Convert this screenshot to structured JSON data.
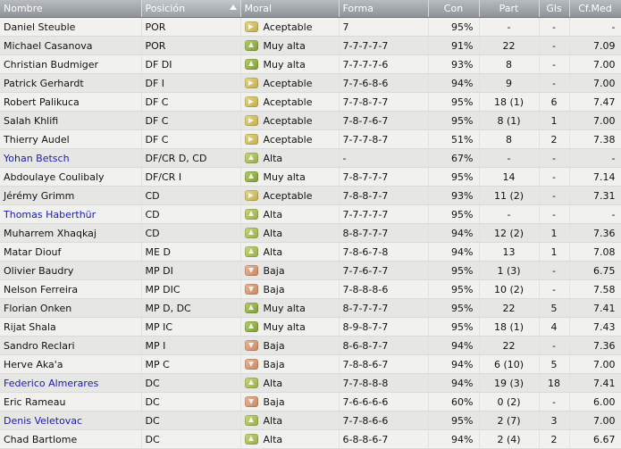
{
  "columns": {
    "name": "Nombre",
    "position": "Posición",
    "morale": "Moral",
    "form": "Forma",
    "condition": "Con",
    "appearances": "Part",
    "goals": "Gls",
    "avg_rating": "Cf.Med"
  },
  "sorted_column": "position",
  "rows": [
    {
      "name": "Daniel Steuble",
      "link": false,
      "position": "POR",
      "morale": "Aceptable",
      "morale_icon": "aceptable",
      "form": "7",
      "condition": "95%",
      "appearances": "-",
      "goals": "-",
      "avg_rating": "-"
    },
    {
      "name": "Michael Casanova",
      "link": false,
      "position": "POR",
      "morale": "Muy alta",
      "morale_icon": "muyalta",
      "form": "7-7-7-7-7",
      "condition": "91%",
      "appearances": "22",
      "goals": "-",
      "avg_rating": "7.09"
    },
    {
      "name": "Christian Budmiger",
      "link": false,
      "position": "DF DI",
      "morale": "Muy alta",
      "morale_icon": "muyalta",
      "form": "7-7-7-7-6",
      "condition": "93%",
      "appearances": "8",
      "goals": "-",
      "avg_rating": "7.00"
    },
    {
      "name": "Patrick Gerhardt",
      "link": false,
      "position": "DF I",
      "morale": "Aceptable",
      "morale_icon": "aceptable",
      "form": "7-7-6-8-6",
      "condition": "94%",
      "appearances": "9",
      "goals": "-",
      "avg_rating": "7.00"
    },
    {
      "name": "Robert Palikuca",
      "link": false,
      "position": "DF C",
      "morale": "Aceptable",
      "morale_icon": "aceptable",
      "form": "7-7-8-7-7",
      "condition": "95%",
      "appearances": "18 (1)",
      "goals": "6",
      "avg_rating": "7.47"
    },
    {
      "name": "Salah Khlifi",
      "link": false,
      "position": "DF C",
      "morale": "Aceptable",
      "morale_icon": "aceptable",
      "form": "7-8-7-6-7",
      "condition": "95%",
      "appearances": "8 (1)",
      "goals": "1",
      "avg_rating": "7.00"
    },
    {
      "name": "Thierry Audel",
      "link": false,
      "position": "DF C",
      "morale": "Aceptable",
      "morale_icon": "aceptable",
      "form": "7-7-7-8-7",
      "condition": "51%",
      "appearances": "8",
      "goals": "2",
      "avg_rating": "7.38"
    },
    {
      "name": "Yohan Betsch",
      "link": true,
      "position": "DF/CR D, CD",
      "morale": "Alta",
      "morale_icon": "alta",
      "form": "-",
      "condition": "67%",
      "appearances": "-",
      "goals": "-",
      "avg_rating": "-"
    },
    {
      "name": "Abdoulaye Coulibaly",
      "link": false,
      "position": "DF/CR I",
      "morale": "Muy alta",
      "morale_icon": "muyalta",
      "form": "7-8-7-7-7",
      "condition": "95%",
      "appearances": "14",
      "goals": "-",
      "avg_rating": "7.14"
    },
    {
      "name": "Jérémy Grimm",
      "link": false,
      "position": "CD",
      "morale": "Aceptable",
      "morale_icon": "aceptable",
      "form": "7-8-8-7-7",
      "condition": "93%",
      "appearances": "11 (2)",
      "goals": "-",
      "avg_rating": "7.31"
    },
    {
      "name": "Thomas Haberthür",
      "link": true,
      "position": "CD",
      "morale": "Alta",
      "morale_icon": "alta",
      "form": "7-7-7-7-7",
      "condition": "95%",
      "appearances": "-",
      "goals": "-",
      "avg_rating": "-"
    },
    {
      "name": "Muharrem Xhaqkaj",
      "link": false,
      "position": "CD",
      "morale": "Alta",
      "morale_icon": "alta",
      "form": "8-8-7-7-7",
      "condition": "94%",
      "appearances": "12 (2)",
      "goals": "1",
      "avg_rating": "7.36"
    },
    {
      "name": "Matar Diouf",
      "link": false,
      "position": "ME D",
      "morale": "Alta",
      "morale_icon": "alta",
      "form": "7-8-6-7-8",
      "condition": "94%",
      "appearances": "13",
      "goals": "1",
      "avg_rating": "7.08"
    },
    {
      "name": "Olivier Baudry",
      "link": false,
      "position": "MP DI",
      "morale": "Baja",
      "morale_icon": "baja",
      "form": "7-7-6-7-7",
      "condition": "95%",
      "appearances": "1 (3)",
      "goals": "-",
      "avg_rating": "6.75"
    },
    {
      "name": "Nelson Ferreira",
      "link": false,
      "position": "MP DIC",
      "morale": "Baja",
      "morale_icon": "baja",
      "form": "7-8-8-8-6",
      "condition": "95%",
      "appearances": "10 (2)",
      "goals": "-",
      "avg_rating": "7.58"
    },
    {
      "name": "Florian Onken",
      "link": false,
      "position": "MP D, DC",
      "morale": "Muy alta",
      "morale_icon": "muyalta",
      "form": "8-7-7-7-7",
      "condition": "95%",
      "appearances": "22",
      "goals": "5",
      "avg_rating": "7.41"
    },
    {
      "name": "Rijat Shala",
      "link": false,
      "position": "MP IC",
      "morale": "Muy alta",
      "morale_icon": "muyalta",
      "form": "8-9-8-7-7",
      "condition": "95%",
      "appearances": "18 (1)",
      "goals": "4",
      "avg_rating": "7.43"
    },
    {
      "name": "Sandro Reclari",
      "link": false,
      "position": "MP I",
      "morale": "Baja",
      "morale_icon": "baja",
      "form": "8-6-8-7-7",
      "condition": "94%",
      "appearances": "22",
      "goals": "-",
      "avg_rating": "7.36"
    },
    {
      "name": "Herve Aka'a",
      "link": false,
      "position": "MP C",
      "morale": "Baja",
      "morale_icon": "baja",
      "form": "7-8-8-6-7",
      "condition": "94%",
      "appearances": "6 (10)",
      "goals": "5",
      "avg_rating": "7.00"
    },
    {
      "name": "Federico Almerares",
      "link": true,
      "position": "DC",
      "morale": "Alta",
      "morale_icon": "alta",
      "form": "7-7-8-8-8",
      "condition": "94%",
      "appearances": "19 (3)",
      "goals": "18",
      "avg_rating": "7.41"
    },
    {
      "name": "Eric Rameau",
      "link": false,
      "position": "DC",
      "morale": "Baja",
      "morale_icon": "baja",
      "form": "7-6-6-6-6",
      "condition": "60%",
      "appearances": "0 (2)",
      "goals": "-",
      "avg_rating": "6.00"
    },
    {
      "name": "Denis Veletovac",
      "link": true,
      "position": "DC",
      "morale": "Alta",
      "morale_icon": "alta",
      "form": "7-7-8-6-6",
      "condition": "95%",
      "appearances": "2 (7)",
      "goals": "3",
      "avg_rating": "7.00"
    },
    {
      "name": "Chad Bartlome",
      "link": false,
      "position": "DC",
      "morale": "Alta",
      "morale_icon": "alta",
      "form": "6-8-8-6-7",
      "condition": "94%",
      "appearances": "2 (4)",
      "goals": "2",
      "avg_rating": "6.67"
    }
  ]
}
